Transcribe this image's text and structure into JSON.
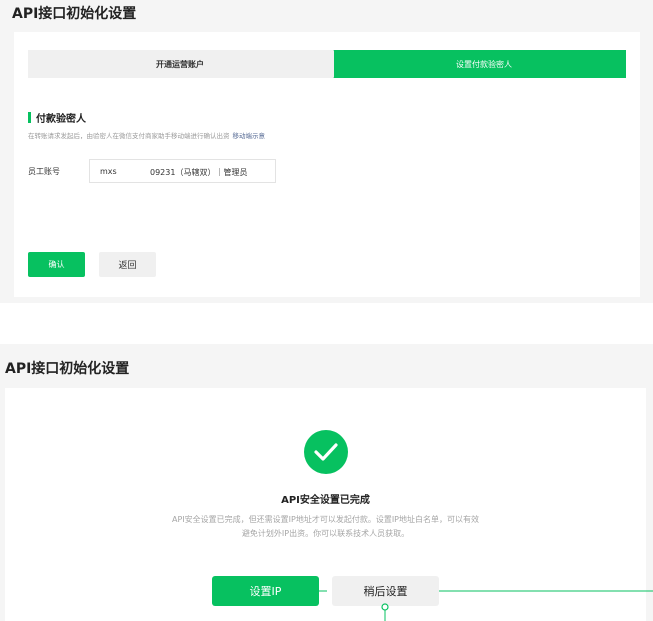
{
  "panel1": {
    "title": "API接口初始化设置",
    "steps": [
      {
        "label": "开通运营账户"
      },
      {
        "label": "设置付款验密人"
      }
    ],
    "section_title": "付款验密人",
    "section_desc": "在转账请求发起后，由验密人在微信支付商家助手移动端进行确认出资",
    "section_link": "移动端示意",
    "employee_label": "员工账号",
    "employee_value_prefix": "mxs",
    "employee_value_suffix": "09231（马辖双）｜管理员",
    "confirm_label": "确认",
    "back_label": "返回"
  },
  "panel2": {
    "title": "API接口初始化设置",
    "done_title": "API安全设置已完成",
    "done_desc": "API安全设置已完成，但还需设置IP地址才可以发起付款。设置IP地址白名单，可以有效避免计划外IP出资。你可以联系技术人员获取。",
    "set_ip_label": "设置IP",
    "later_label": "稍后设置"
  },
  "colors": {
    "brand_green": "#07c160",
    "link_blue": "#576b95",
    "page_gray": "#f5f5f5"
  },
  "icons": {
    "success": "check-circle-icon",
    "step_arrow": "chevron-right-icon"
  }
}
